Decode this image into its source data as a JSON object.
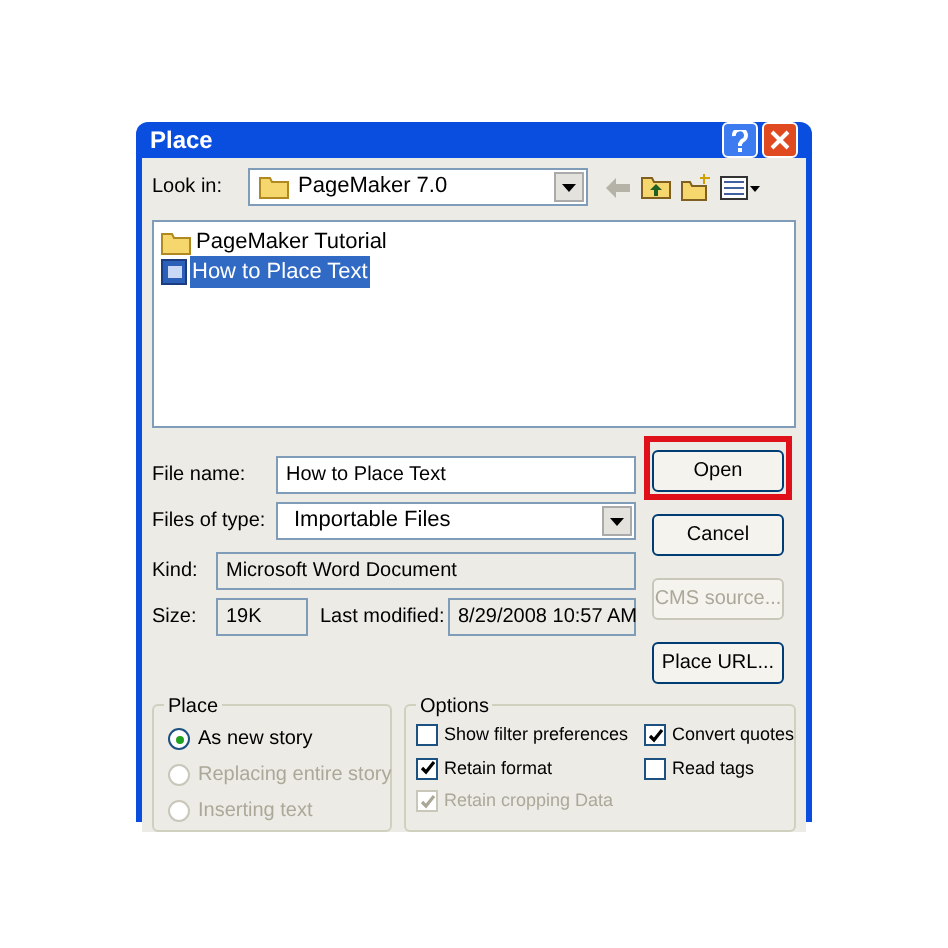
{
  "window": {
    "title": "Place"
  },
  "look_in": {
    "label": "Look in:",
    "value": "PageMaker 7.0"
  },
  "files": [
    {
      "kind": "folder",
      "name": "PageMaker Tutorial",
      "selected": false
    },
    {
      "kind": "document",
      "name": "How to Place Text",
      "selected": true
    }
  ],
  "file_name": {
    "label": "File name:",
    "value": "How to Place Text"
  },
  "files_of_type": {
    "label": "Files of type:",
    "value": "Importable Files"
  },
  "kind": {
    "label": "Kind:",
    "value": "Microsoft Word Document"
  },
  "size": {
    "label": "Size:",
    "value": "19K"
  },
  "last_modified": {
    "label": "Last modified:",
    "value": "8/29/2008 10:57 AM"
  },
  "buttons": [
    {
      "label": "Open",
      "disabled": false,
      "highlighted": true
    },
    {
      "label": "Cancel",
      "disabled": false,
      "highlighted": false
    },
    {
      "label": "CMS source...",
      "disabled": true,
      "highlighted": false
    },
    {
      "label": "Place URL...",
      "disabled": false,
      "highlighted": false
    }
  ],
  "place": {
    "title": "Place",
    "options": [
      {
        "label": "As new story",
        "selected": true,
        "disabled": false
      },
      {
        "label": "Replacing entire story",
        "selected": false,
        "disabled": true
      },
      {
        "label": "Inserting text",
        "selected": false,
        "disabled": true
      }
    ]
  },
  "options": {
    "title": "Options",
    "items": [
      {
        "label": "Show filter preferences",
        "checked": false,
        "disabled": false
      },
      {
        "label": "Convert quotes",
        "checked": true,
        "disabled": false
      },
      {
        "label": "Retain format",
        "checked": true,
        "disabled": false
      },
      {
        "label": "Read tags",
        "checked": false,
        "disabled": false
      },
      {
        "label": "Retain cropping Data",
        "checked": true,
        "disabled": true
      }
    ]
  }
}
